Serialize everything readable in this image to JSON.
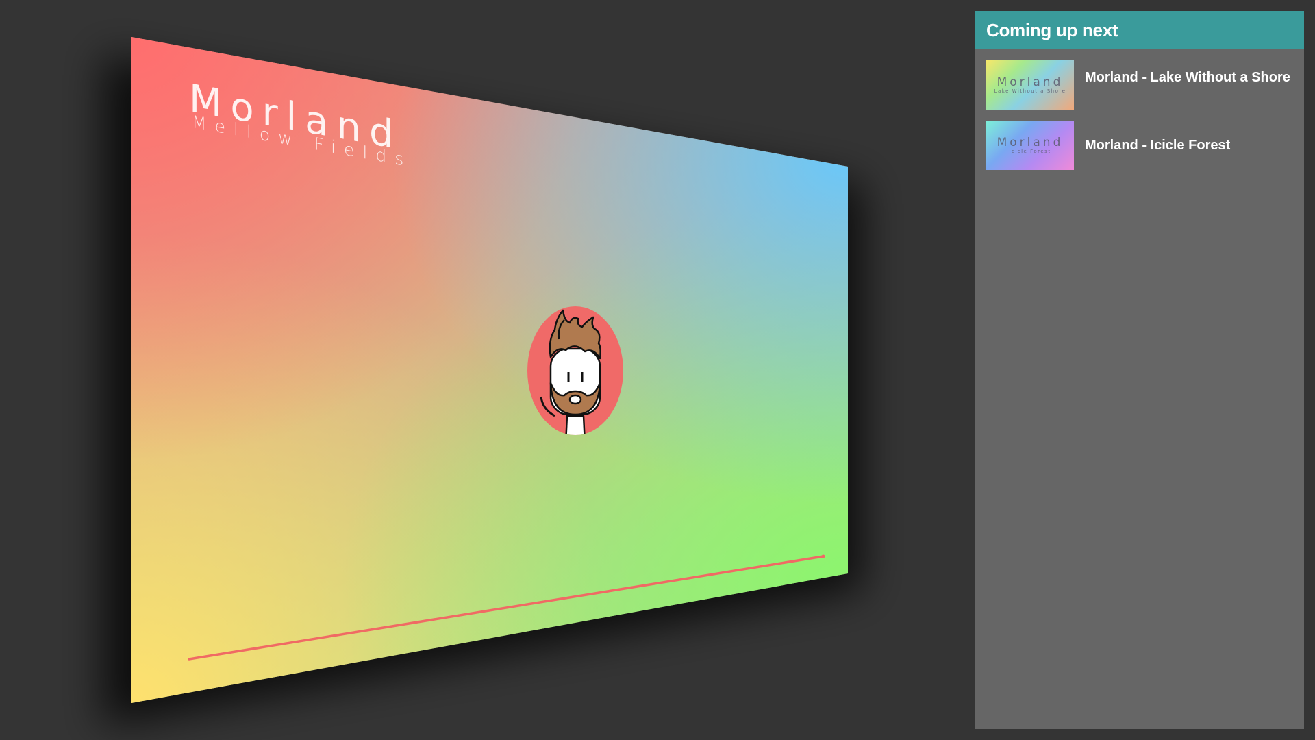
{
  "video": {
    "title": "Morland",
    "subtitle": "Mellow Fields",
    "progress_percent": 100
  },
  "sidebar": {
    "header": "Coming up next",
    "items": [
      {
        "thumb_title": "Morland",
        "thumb_subtitle": "Lake Without a Shore",
        "label": "Morland - Lake Without a Shore"
      },
      {
        "thumb_title": "Morland",
        "thumb_subtitle": "Icicle Forest",
        "label": "Morland - Icicle Forest"
      }
    ]
  },
  "colors": {
    "background": "#343434",
    "panel": "#666666",
    "panel_header": "#3a9b9b",
    "progress_line": "#f06a64",
    "avatar_bg": "#f06a68"
  },
  "icons": {
    "avatar": "bearded-character-avatar"
  }
}
